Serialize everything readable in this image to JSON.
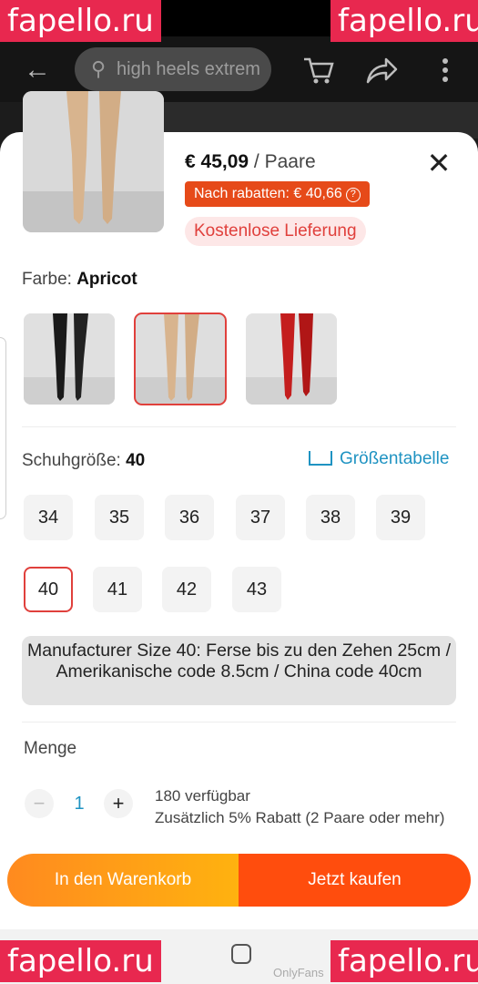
{
  "watermarks": {
    "text": "fapello.ru"
  },
  "toolbar": {
    "search_placeholder": "high heels extrem"
  },
  "product": {
    "price": "€ 45,09",
    "unit": " / Paare",
    "discount": "Nach rabatten: € 40,66",
    "shipping": "Kostenlose Lieferung"
  },
  "color": {
    "label": "Farbe:",
    "selected": "Apricot",
    "options": [
      {
        "name": "black",
        "swatch": "#1a1a1a"
      },
      {
        "name": "apricot",
        "swatch": "#d4b08c"
      },
      {
        "name": "red",
        "swatch": "#c41e1e"
      }
    ]
  },
  "size": {
    "label": "Schuhgröße:",
    "selected": "40",
    "chart_link": "Größentabelle",
    "options": [
      "34",
      "35",
      "36",
      "37",
      "38",
      "39",
      "40",
      "41",
      "42",
      "43"
    ],
    "info": "Manufacturer Size 40: Ferse bis zu den Zehen 25cm / Amerikanische code 8.5cm / China code 40cm"
  },
  "quantity": {
    "label": "Menge",
    "minus": "−",
    "value": "1",
    "plus": "+",
    "stock": "180 verfügbar",
    "bulk": "Zusätzlich 5% Rabatt (2 Paare oder mehr)"
  },
  "actions": {
    "add_to_cart": "In den Warenkorb",
    "buy_now": "Jetzt kaufen"
  },
  "nav": {
    "caption": "OnlyFans"
  },
  "colors": {
    "accent_red": "#e0403c",
    "link_blue": "#1f93c2",
    "cart_orange": "#ffa015",
    "buy_orange": "#ff4d0d"
  }
}
